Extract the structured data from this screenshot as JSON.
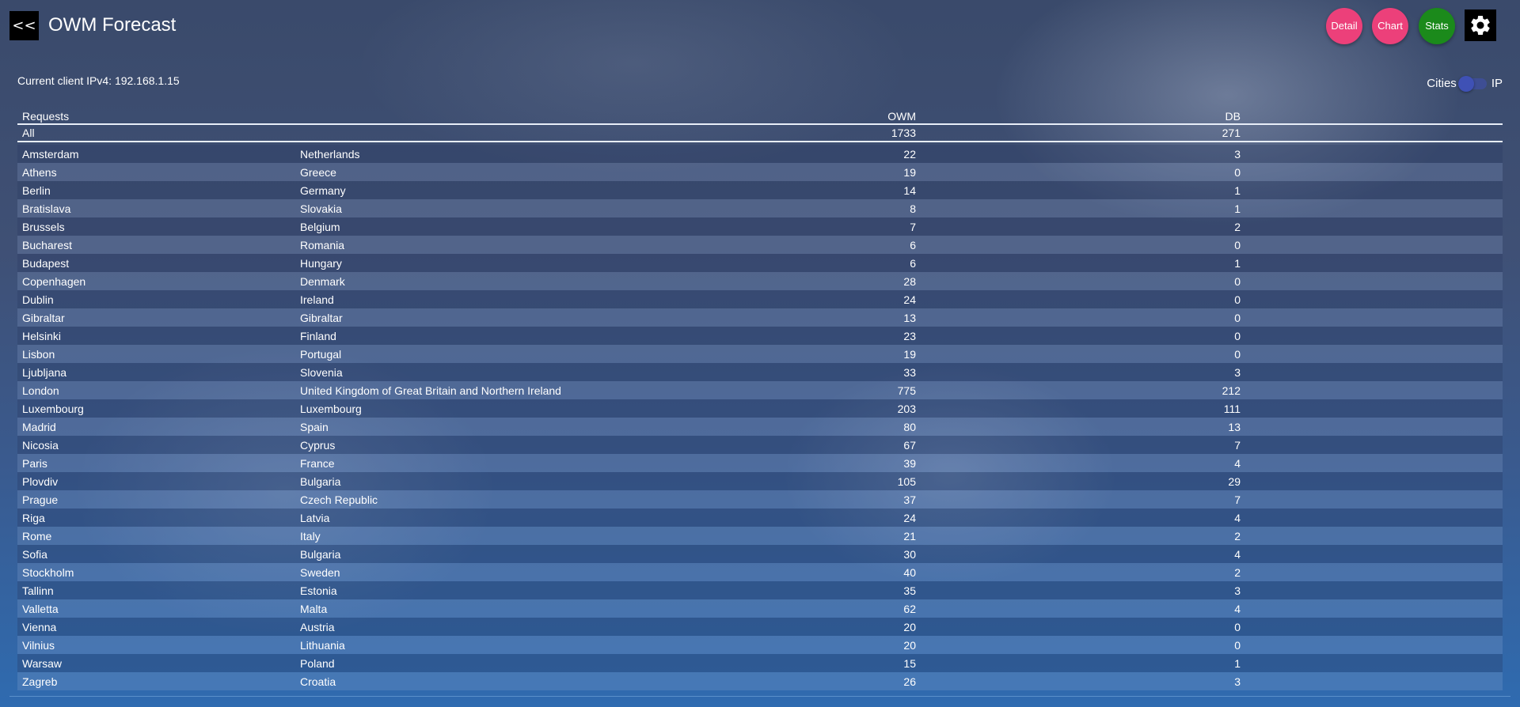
{
  "header": {
    "back_label": "<<",
    "title": "OWM Forecast",
    "buttons": {
      "detail": "Detail",
      "chart": "Chart",
      "stats": "Stats"
    },
    "colors": {
      "detail": "#ec407a",
      "chart": "#ec407a",
      "stats": "#1b8a1b"
    }
  },
  "client_ip": "Current client IPv4: 192.168.1.15",
  "toggle": {
    "left_label": "Cities",
    "right_label": "IP"
  },
  "table": {
    "headers": {
      "requests": "Requests",
      "owm": "OWM",
      "db": "DB"
    },
    "all": {
      "label": "All",
      "owm": "1733",
      "db": "271"
    },
    "rows": [
      {
        "city": "Amsterdam",
        "country": "Netherlands",
        "owm": "22",
        "db": "3"
      },
      {
        "city": "Athens",
        "country": "Greece",
        "owm": "19",
        "db": "0"
      },
      {
        "city": "Berlin",
        "country": "Germany",
        "owm": "14",
        "db": "1"
      },
      {
        "city": "Bratislava",
        "country": "Slovakia",
        "owm": "8",
        "db": "1"
      },
      {
        "city": "Brussels",
        "country": "Belgium",
        "owm": "7",
        "db": "2"
      },
      {
        "city": "Bucharest",
        "country": "Romania",
        "owm": "6",
        "db": "0"
      },
      {
        "city": "Budapest",
        "country": "Hungary",
        "owm": "6",
        "db": "1"
      },
      {
        "city": "Copenhagen",
        "country": "Denmark",
        "owm": "28",
        "db": "0"
      },
      {
        "city": "Dublin",
        "country": "Ireland",
        "owm": "24",
        "db": "0"
      },
      {
        "city": "Gibraltar",
        "country": "Gibraltar",
        "owm": "13",
        "db": "0"
      },
      {
        "city": "Helsinki",
        "country": "Finland",
        "owm": "23",
        "db": "0"
      },
      {
        "city": "Lisbon",
        "country": "Portugal",
        "owm": "19",
        "db": "0"
      },
      {
        "city": "Ljubljana",
        "country": "Slovenia",
        "owm": "33",
        "db": "3"
      },
      {
        "city": "London",
        "country": "United Kingdom of Great Britain and Northern Ireland",
        "owm": "775",
        "db": "212"
      },
      {
        "city": "Luxembourg",
        "country": "Luxembourg",
        "owm": "203",
        "db": "111"
      },
      {
        "city": "Madrid",
        "country": "Spain",
        "owm": "80",
        "db": "13"
      },
      {
        "city": "Nicosia",
        "country": "Cyprus",
        "owm": "67",
        "db": "7"
      },
      {
        "city": "Paris",
        "country": "France",
        "owm": "39",
        "db": "4"
      },
      {
        "city": "Plovdiv",
        "country": "Bulgaria",
        "owm": "105",
        "db": "29"
      },
      {
        "city": "Prague",
        "country": "Czech Republic",
        "owm": "37",
        "db": "7"
      },
      {
        "city": "Riga",
        "country": "Latvia",
        "owm": "24",
        "db": "4"
      },
      {
        "city": "Rome",
        "country": "Italy",
        "owm": "21",
        "db": "2"
      },
      {
        "city": "Sofia",
        "country": "Bulgaria",
        "owm": "30",
        "db": "4"
      },
      {
        "city": "Stockholm",
        "country": "Sweden",
        "owm": "40",
        "db": "2"
      },
      {
        "city": "Tallinn",
        "country": "Estonia",
        "owm": "35",
        "db": "3"
      },
      {
        "city": "Valletta",
        "country": "Malta",
        "owm": "62",
        "db": "4"
      },
      {
        "city": "Vienna",
        "country": "Austria",
        "owm": "20",
        "db": "0"
      },
      {
        "city": "Vilnius",
        "country": "Lithuania",
        "owm": "20",
        "db": "0"
      },
      {
        "city": "Warsaw",
        "country": "Poland",
        "owm": "15",
        "db": "1"
      },
      {
        "city": "Zagreb",
        "country": "Croatia",
        "owm": "26",
        "db": "3"
      }
    ]
  }
}
